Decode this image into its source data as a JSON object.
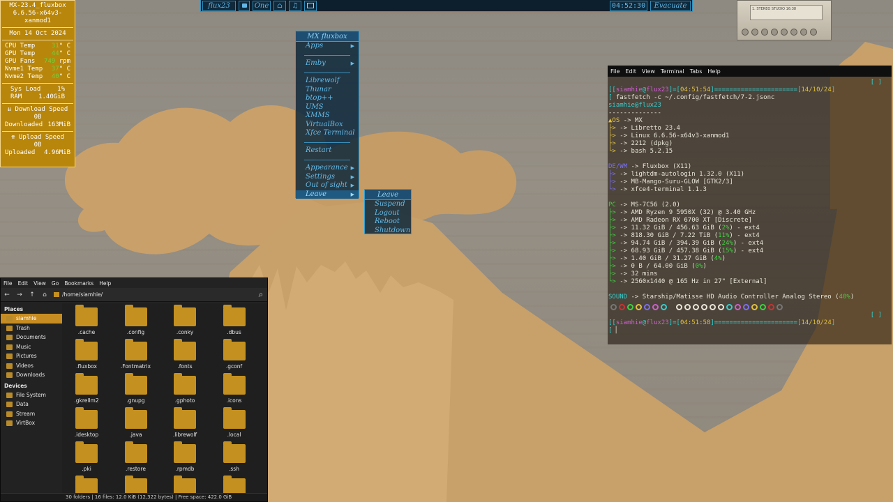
{
  "conky": {
    "title": "MX-23.4_fluxbox",
    "kernel": "6.6.56-x64v3-xanmod1",
    "date": "Mon 14 Oct 2024",
    "cpu_temp_label": "CPU Temp",
    "cpu_temp_val": "31",
    "cpu_temp_unit": "° C",
    "gpu_temp_label": "GPU Temp",
    "gpu_temp_val": "44",
    "gpu_temp_unit": "° C",
    "gpu_fans_label": "GPU Fans",
    "gpu_fans_val": "749",
    "gpu_fans_unit": "rpm",
    "nvme1_label": "Nvme1 Temp",
    "nvme1_val": "37",
    "nvme1_unit": "° C",
    "nvme2_label": "Nvme2 Temp",
    "nvme2_val": "40",
    "nvme2_unit": "° C",
    "sysload_label": "Sys Load",
    "sysload_val": "1%",
    "ram_label": "RAM",
    "ram_val": "1.40GiB",
    "dl_speed_label": "⇊ Download Speed",
    "dl_speed_val": "0B",
    "downloaded_label": "Downloaded",
    "downloaded_val": "163MiB",
    "ul_speed_label": "⇈ Upload Speed",
    "ul_speed_val": "0B",
    "uploaded_label": "Uploaded",
    "uploaded_val": "4.96MiB"
  },
  "toolbar": {
    "brand": "flux23",
    "workspace": "One",
    "clock": "04:52:30",
    "exit_label": "Evacuate"
  },
  "xmms": {
    "display_text": "1. STEREO STUDIO 16:38"
  },
  "menu": {
    "title": "MX fluxbox",
    "items": [
      "Apps",
      "Emby",
      "Librewolf",
      "Thunar",
      "btop++",
      "UMS",
      "XMMS",
      "VirtualBox",
      "Xfce Terminal",
      "Restart",
      "Appearance",
      "Settings",
      "Out of sight",
      "Leave"
    ],
    "submenu_title": "Leave",
    "submenu_items": [
      "Suspend",
      "Logout",
      "Reboot",
      "Shutdown"
    ]
  },
  "terminal": {
    "menubar": [
      "File",
      "Edit",
      "View",
      "Terminal",
      "Tabs",
      "Help"
    ],
    "prompt_user": "siamhie",
    "prompt_host": "flux23",
    "time1": "04:51:54",
    "date": "14/10/24",
    "command": "fastfetch -c ~/.config/fastfetch/7-2.jsonc",
    "userhost": "siamhie@flux23",
    "rule": "--------------",
    "os_label": "OS",
    "os_val": "MX",
    "os_lines": [
      "Libretto 23.4",
      "Linux 6.6.56-x64v3-xanmod1",
      "2212 (dpkg)",
      "bash 5.2.15"
    ],
    "de_label": "DE/WM",
    "de_val": "Fluxbox (X11)",
    "de_lines": [
      "lightdm-autologin 1.32.0 (X11)",
      "MB-Mango-Suru-GLOW [GTK2/3]",
      "xfce4-terminal 1.1.3"
    ],
    "pc_label": "PC",
    "pc_val": "MS-7C56 (2.0)",
    "pc_lines": [
      {
        "text": "AMD Ryzen 9 5950X (32) @ 3.40 GHz",
        "pct": "",
        "tail": ""
      },
      {
        "text": "AMD Radeon RX 6700 XT [Discrete]",
        "pct": "",
        "tail": ""
      },
      {
        "text": "11.32 GiB / 456.63 GiB (",
        "pct": "2%",
        "tail": ") - ext4"
      },
      {
        "text": "818.30 GiB / 7.22 TiB (",
        "pct": "11%",
        "tail": ") - ext4"
      },
      {
        "text": "94.74 GiB / 394.39 GiB (",
        "pct": "24%",
        "tail": ") - ext4"
      },
      {
        "text": "68.93 GiB / 457.38 GiB (",
        "pct": "15%",
        "tail": ") - ext4"
      },
      {
        "text": "1.40 GiB / 31.27 GiB (",
        "pct": "4%",
        "tail": ")"
      },
      {
        "text": "0 B / 64.00 GiB (",
        "pct": "0%",
        "tail": ")"
      },
      {
        "text": "32 mins",
        "pct": "",
        "tail": ""
      },
      {
        "text": "2560x1440 @ 165 Hz in 27\" [External]",
        "pct": "",
        "tail": ""
      }
    ],
    "sound_label": "SOUND",
    "sound_val": "Starship/Matisse HD Audio Controller Analog Stereo (",
    "sound_pct": "40%",
    "sound_tail": ")",
    "time2": "04:51:58",
    "dot_colors": [
      "#777777",
      "#d03030",
      "#3fd040",
      "#e0c040",
      "#7a70f0",
      "#cf5fd0",
      "#33d0d0",
      "#e8e4d8",
      "#e8e4d8",
      "#e8e4d8",
      "#e8e4d8",
      "#e8e4d8",
      "#e8e4d8",
      "#33d0d0",
      "#cf5fd0",
      "#7a70f0",
      "#e0c040",
      "#3fd040",
      "#d03030",
      "#777777"
    ]
  },
  "filemanager": {
    "menubar": [
      "File",
      "Edit",
      "View",
      "Go",
      "Bookmarks",
      "Help"
    ],
    "path": "/home/siamhie/",
    "places_header": "Places",
    "places": [
      "siamhie",
      "Trash",
      "Documents",
      "Music",
      "Pictures",
      "Videos",
      "Downloads"
    ],
    "devices_header": "Devices",
    "devices": [
      "File System",
      "Data",
      "Stream",
      "VirtBox"
    ],
    "folders": [
      ".cache",
      ".config",
      ".conky",
      ".dbus",
      ".fluxbox",
      ".Fontmatrix",
      ".fonts",
      ".gconf",
      ".gkrellm2",
      ".gnupg",
      ".gphoto",
      ".icons",
      ".idesktop",
      ".java",
      ".librewolf",
      ".local",
      ".pki",
      ".restore",
      ".rpmdb",
      ".ssh"
    ],
    "status": "30 folders  |  16 files: 12.0 KiB (12,322 bytes)  |  Free space: 422.0 GiB"
  },
  "colors": {
    "accent": "#2e9fd3",
    "conky_bg": "#b8860b",
    "folder": "#c4901f"
  }
}
